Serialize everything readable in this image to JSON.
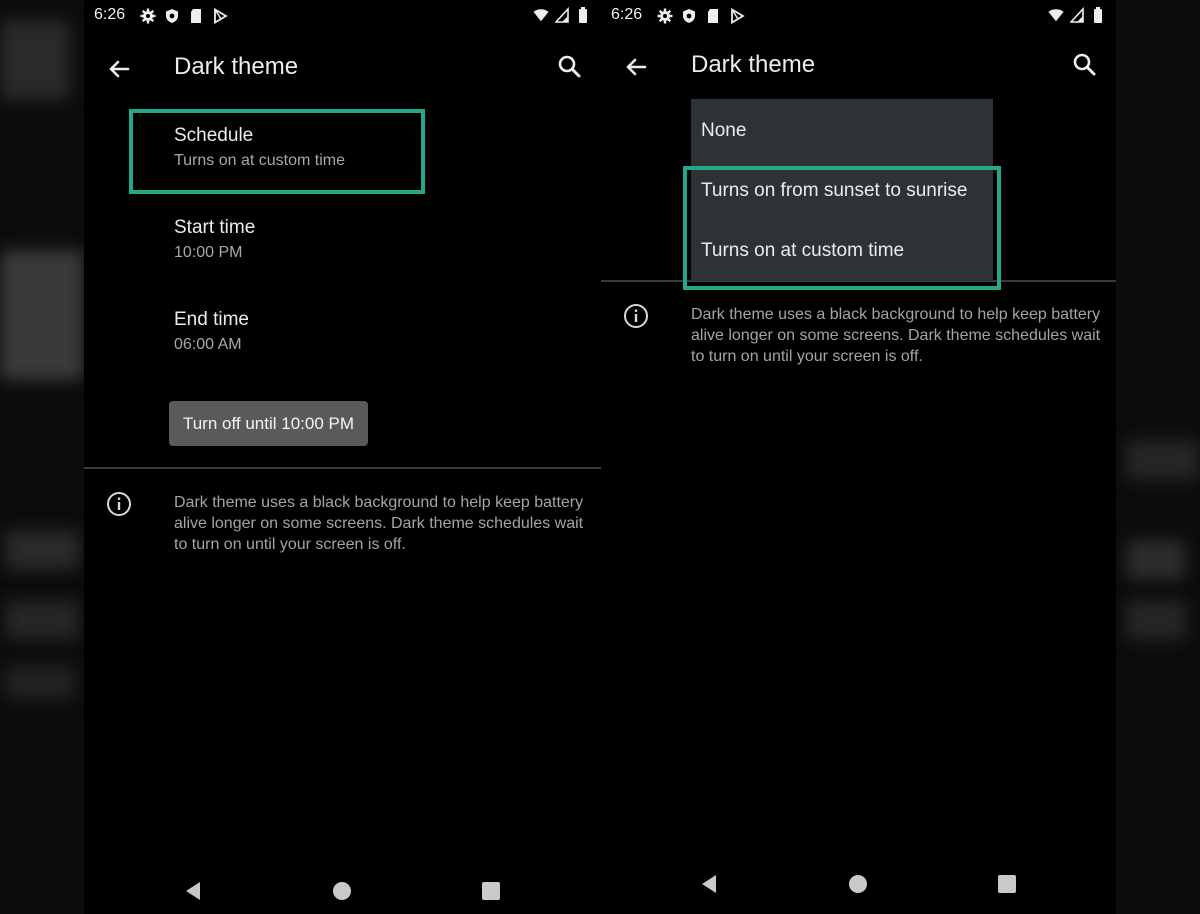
{
  "left_screen": {
    "status_time": "6:26",
    "title": "Dark theme",
    "schedule": {
      "title": "Schedule",
      "summary": "Turns on at custom time"
    },
    "start_time": {
      "title": "Start time",
      "value": "10:00 PM"
    },
    "end_time": {
      "title": "End time",
      "value": "06:00 AM"
    },
    "turn_off_button": "Turn off until 10:00 PM",
    "info_text": "Dark theme uses a black background to help keep battery alive longer on some screens. Dark theme schedules wait to turn on until your screen is off."
  },
  "right_screen": {
    "status_time": "6:26",
    "title": "Dark theme",
    "menu_options": [
      "None",
      "Turns on from sunset to sunrise",
      "Turns on at custom time"
    ],
    "info_text": "Dark theme uses a black background to help keep battery alive longer on some screens. Dark theme schedules wait to turn on until your screen is off."
  },
  "colors": {
    "highlight": "#23a98a",
    "background": "#000000",
    "menu_background": "#2f3234",
    "button_background": "#5a5a5a"
  },
  "icons": {
    "status_left": [
      "gear-icon",
      "shield-icon",
      "sd-card-icon",
      "play-store-icon"
    ],
    "status_right": [
      "wifi-icon",
      "signal-icon",
      "battery-icon"
    ],
    "appbar": [
      "back-arrow-icon",
      "search-icon"
    ],
    "nav": [
      "back-triangle-icon",
      "home-circle-icon",
      "recents-square-icon"
    ]
  }
}
